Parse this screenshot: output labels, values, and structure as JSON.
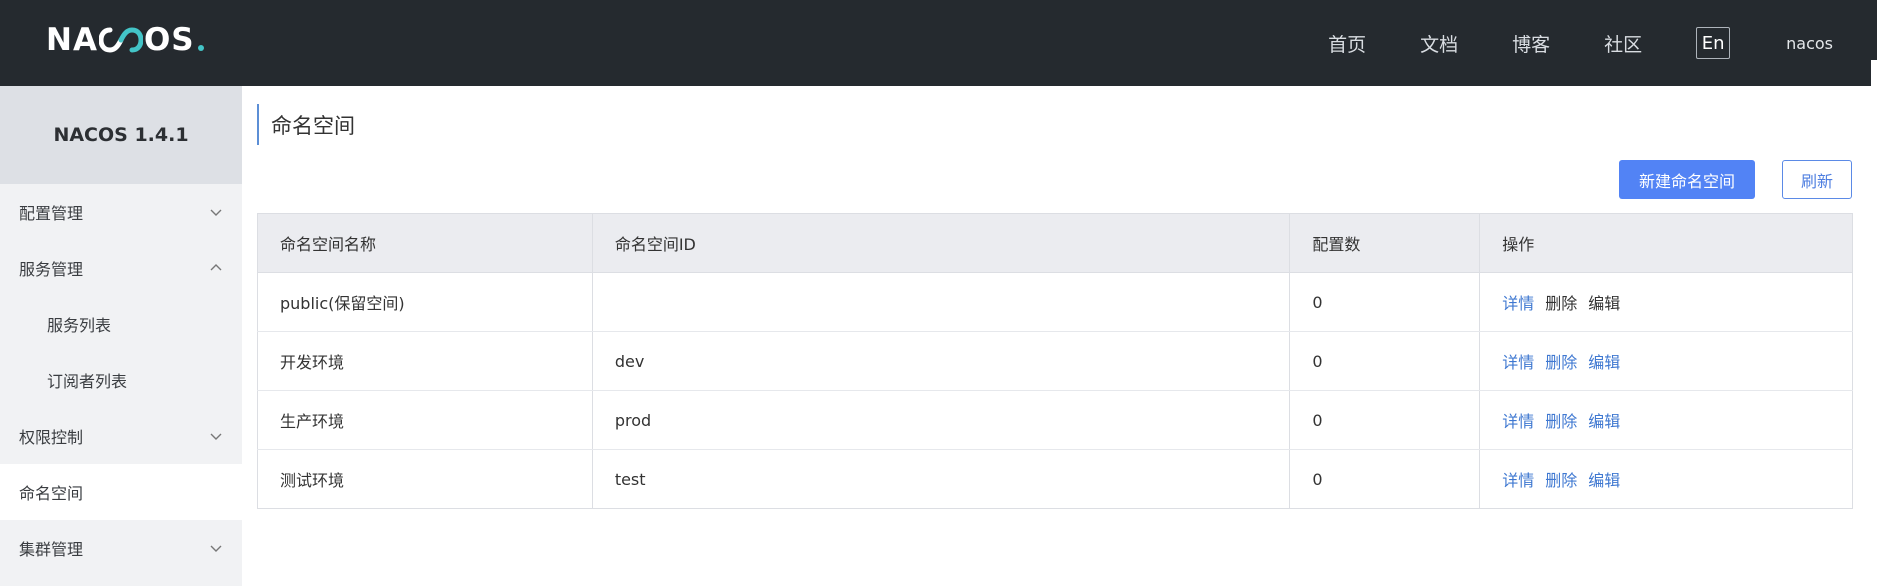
{
  "header": {
    "logo_text_1": "NA",
    "logo_text_2": "OS",
    "nav": [
      "首页",
      "文档",
      "博客",
      "社区"
    ],
    "lang_button": "En",
    "user": "nacos",
    "colors": {
      "background": "#252a2f",
      "logo_accent": "#43c4c7"
    }
  },
  "sidebar": {
    "version": "NACOS 1.4.1",
    "items": [
      {
        "label": "配置管理",
        "icon": "chevron-down-icon"
      },
      {
        "label": "服务管理",
        "icon": "chevron-up-icon"
      },
      {
        "label": "服务列表"
      },
      {
        "label": "订阅者列表"
      },
      {
        "label": "权限控制",
        "icon": "chevron-down-icon"
      },
      {
        "label": "命名空间"
      },
      {
        "label": "集群管理",
        "icon": "chevron-down-icon"
      }
    ]
  },
  "main": {
    "title": "命名空间",
    "new_button": "新建命名空间",
    "refresh_button": "刷新",
    "table": {
      "columns": [
        "命名空间名称",
        "命名空间ID",
        "配置数",
        "操作"
      ],
      "rows": [
        {
          "name": "public(保留空间)",
          "id": "",
          "count": "0",
          "actions": [
            "详情",
            "删除",
            "编辑"
          ]
        },
        {
          "name": "开发环境",
          "id": "dev",
          "count": "0",
          "actions": [
            "详情",
            "删除",
            "编辑"
          ]
        },
        {
          "name": "生产环境",
          "id": "prod",
          "count": "0",
          "actions": [
            "详情",
            "删除",
            "编辑"
          ]
        },
        {
          "name": "测试环境",
          "id": "test",
          "count": "0",
          "actions": [
            "详情",
            "删除",
            "编辑"
          ]
        }
      ]
    },
    "colors": {
      "primary": "#5283f5",
      "link": "#3f78d1",
      "title_accent": "#5c8fd6"
    }
  }
}
